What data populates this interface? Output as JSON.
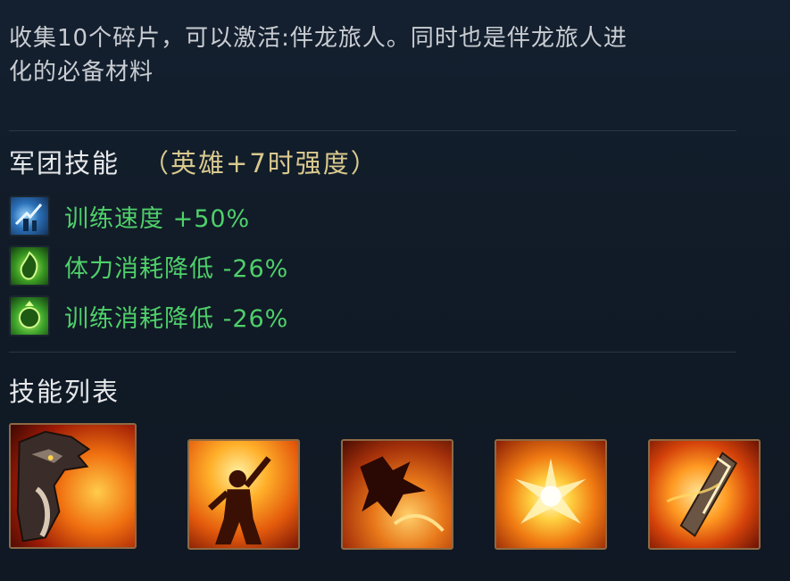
{
  "description": {
    "line1": "收集10个碎片，可以激活:伴龙旅人。同时也是伴龙旅人进",
    "line2": "化的必备材料"
  },
  "legion_skills": {
    "title": "军团技能",
    "note": "（英雄+7时强度）",
    "buffs": [
      {
        "icon": "training-icon",
        "label": "训练速度 +50%"
      },
      {
        "icon": "stamina-icon",
        "label": "体力消耗降低 -26%"
      },
      {
        "icon": "training-cost-icon",
        "label": "训练消耗降低 -26%"
      }
    ]
  },
  "skill_list": {
    "title": "技能列表",
    "skills": [
      {
        "icon": "dragon-portrait-icon"
      },
      {
        "icon": "fire-warrior-icon"
      },
      {
        "icon": "flame-dragon-icon"
      },
      {
        "icon": "fire-explosion-icon"
      },
      {
        "icon": "fire-blade-icon"
      }
    ]
  },
  "colors": {
    "buff_text": "#4fd06a",
    "note_text": "#d9c98e",
    "skill_border": "#8d6a45"
  }
}
